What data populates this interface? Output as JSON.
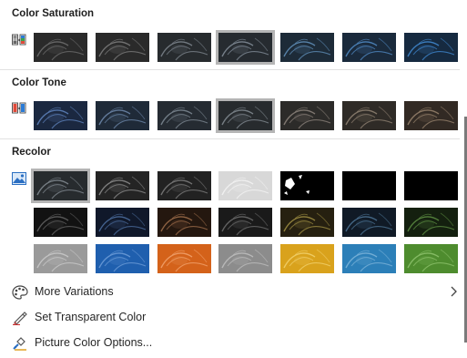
{
  "sections": {
    "saturation": {
      "title": "Color Saturation"
    },
    "tone": {
      "title": "Color Tone"
    },
    "recolor": {
      "title": "Recolor"
    }
  },
  "saturation_swatches": [
    {
      "tint": "#2a2a2a",
      "glow": "#6b6b6b",
      "selected": false
    },
    {
      "tint": "#2a2a2a",
      "glow": "#7a7a7a",
      "selected": false
    },
    {
      "tint": "#272b2e",
      "glow": "#7a828a",
      "selected": false
    },
    {
      "tint": "#262b30",
      "glow": "#7f8a95",
      "selected": true
    },
    {
      "tint": "#1d2b38",
      "glow": "#5e8cb5",
      "selected": false
    },
    {
      "tint": "#1a2a3c",
      "glow": "#4f87c0",
      "selected": false
    },
    {
      "tint": "#162a40",
      "glow": "#3f86cc",
      "selected": false
    }
  ],
  "tone_swatches": [
    {
      "tint": "#1b2840",
      "glow": "#5c7fb8",
      "selected": false
    },
    {
      "tint": "#1f2a38",
      "glow": "#6a84a6",
      "selected": false
    },
    {
      "tint": "#252b32",
      "glow": "#7a858f",
      "selected": false
    },
    {
      "tint": "#272b2e",
      "glow": "#7f878e",
      "selected": true
    },
    {
      "tint": "#2c2b29",
      "glow": "#888078",
      "selected": false
    },
    {
      "tint": "#2f2b27",
      "glow": "#8d7f70",
      "selected": false
    },
    {
      "tint": "#322a24",
      "glow": "#94806a",
      "selected": false
    }
  ],
  "recolor_swatches": [
    [
      {
        "tint": "#272b2e",
        "glow": "#7f878e",
        "selected": true
      },
      {
        "tint": "#242424",
        "glow": "#8a8a8a",
        "selected": false
      },
      {
        "tint": "#222222",
        "glow": "#7a7a7a",
        "selected": false
      },
      {
        "tint": "#d8d8d8",
        "glow": "#f2f2f2",
        "selected": false,
        "light": true
      },
      {
        "tint": "#000000",
        "glow": "#ffffff",
        "selected": false,
        "bw": true
      },
      {
        "tint": "#000000",
        "glow": "#000000",
        "selected": false
      },
      {
        "tint": "#000000",
        "glow": "#000000",
        "selected": false
      }
    ],
    [
      {
        "tint": "#121212",
        "glow": "#606060",
        "selected": false
      },
      {
        "tint": "#10182a",
        "glow": "#4a6a9a",
        "selected": false
      },
      {
        "tint": "#24170f",
        "glow": "#9a6a48",
        "selected": false
      },
      {
        "tint": "#1a1a1a",
        "glow": "#6a6a6a",
        "selected": false
      },
      {
        "tint": "#262010",
        "glow": "#9a8a40",
        "selected": false
      },
      {
        "tint": "#101a26",
        "glow": "#4a7090",
        "selected": false
      },
      {
        "tint": "#14200f",
        "glow": "#5a8a40",
        "selected": false
      }
    ],
    [
      {
        "tint": "#9a9a9a",
        "glow": "#c8c8c8",
        "selected": false
      },
      {
        "tint": "#1f5fae",
        "glow": "#6a9ad6",
        "selected": false
      },
      {
        "tint": "#d4621a",
        "glow": "#f0a06a",
        "selected": false
      },
      {
        "tint": "#8c8c8c",
        "glow": "#bcbcbc",
        "selected": false
      },
      {
        "tint": "#d9a21c",
        "glow": "#f0cf6a",
        "selected": false
      },
      {
        "tint": "#2c7fb8",
        "glow": "#7ab2d8",
        "selected": false
      },
      {
        "tint": "#4e8c2e",
        "glow": "#8cc06a",
        "selected": false
      }
    ]
  ],
  "menu": {
    "more_variations": "More Variations",
    "set_transparent": "Set Transparent Color",
    "color_options": "Picture Color Options..."
  },
  "icons": {
    "saturation": "color-saturation-icon",
    "tone": "color-tone-icon",
    "recolor": "recolor-picture-icon",
    "more_variations": "palette-icon",
    "set_transparent": "transparent-pen-icon",
    "color_options": "picture-color-options-icon",
    "submenu": "chevron-right-icon"
  }
}
